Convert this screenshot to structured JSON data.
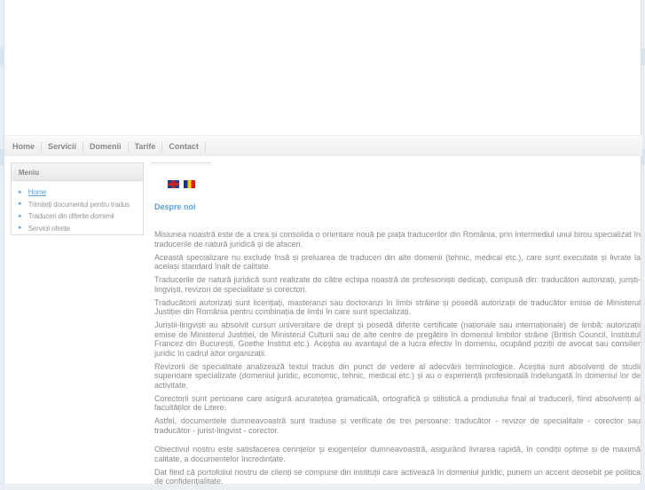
{
  "nav": [
    "Home",
    "Servicii",
    "Domenii",
    "Tarife",
    "Contact"
  ],
  "sidebar": {
    "title": "Meniu",
    "items": [
      "Home",
      "Trimiteți documentul pentru tradus",
      "Traduceri din diferite domenii",
      "Servicii oferite"
    ]
  },
  "languages": [
    "English",
    "Română"
  ],
  "main": {
    "title": "Despre noi",
    "paragraphs": [
      "Misiunea noastră este de a crea și consolida o orientare nouă pe piața traducerilor din România, prin intermediul unui birou specializat în traducerile de natură juridică și de afaceri.",
      "Această specializare nu exclude însă și preluarea de traduceri din alte domenii (tehnic, medical etc.), care sunt executate și livrate la același standard înalt de calitate.",
      "Traducerile de natură juridică sunt realizate de către echipa noastră de profesioniști dedicați, compusă din: traducători autorizați, juriști-lingviști, revizori de specialitate și corectori.",
      "Traducătorii autorizați sunt licențiați, masteranzi sau doctoranzi în limbi străine și posedă autorizații de traducător emise de Ministerul Justiției din România pentru combinația de limbi în care sunt specializați.",
      "Juriștii-lingviști au absolvit cursuri universitare de drept și posedă diferite certificate (naționale sau internaționale) de limbă: autorizații emise de Ministerul Justiției, de Ministerul Culturii sau de alte centre de pregătire în domeniul limbilor străine (British Council, Institutul Francez din București, Goethe Institut etc.). Aceștia au avantajul de a lucra efectiv în domeniu, ocupând poziții de avocat sau consilier juridic în cadrul altor organizații.",
      "Revizorii de specialitate analizează textul tradus din punct de vedere al adecvării terminologice. Aceștia sunt absolvenți de studii superioare specializate (domeniul juridic, economic, tehnic, medical etc.) și au o experiență profesională îndelungată în domeniul lor de activitate.",
      "Corectorii sunt persoane care asigură acuratețea gramaticală, ortografică și stilistică a produsului final al traducerii, fiind absolvenți ai facultăților de Litere.",
      "Astfel, documentele dumneavoastră sunt traduse și verificate de trei persoane: traducător - revizor de specialitate - corector sau traducător - jurist-lingvist - corector.",
      "Obiectivul nostru este satisfacerea cerințelor și exigențelor dumneavoastră, asigurând livrarea rapidă, în condiții optime și de maximă calitate, a documentelor încredințate.",
      "Dat fiind că portofoliul nostru de clienți se compune din instituții care activează în domeniul juridic, punem un accent deosebit pe politica de confidențialitate."
    ]
  }
}
